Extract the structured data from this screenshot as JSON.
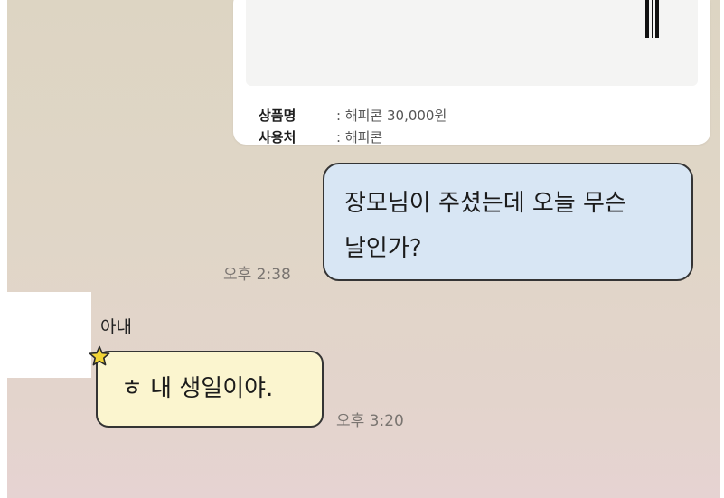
{
  "gift_card": {
    "product_label": "상품명",
    "product_value": ": 해피콘 30,000원",
    "usage_label": "사용처",
    "usage_value": ": 해피콘"
  },
  "messages": [
    {
      "sender": "me",
      "text_line1": "장모님이 주셨는데 오늘 무슨",
      "text_line2": "날인가?",
      "time": "오후 2:38"
    },
    {
      "sender": "아내",
      "text": "ㅎ 내 생일이야.",
      "time": "오후 3:20"
    }
  ],
  "colors": {
    "my_bubble": "#d8e6f4",
    "their_bubble": "#fbf5cf",
    "border": "#343434",
    "star": "#f2d437"
  },
  "icons": {
    "favorite": "star-icon"
  }
}
